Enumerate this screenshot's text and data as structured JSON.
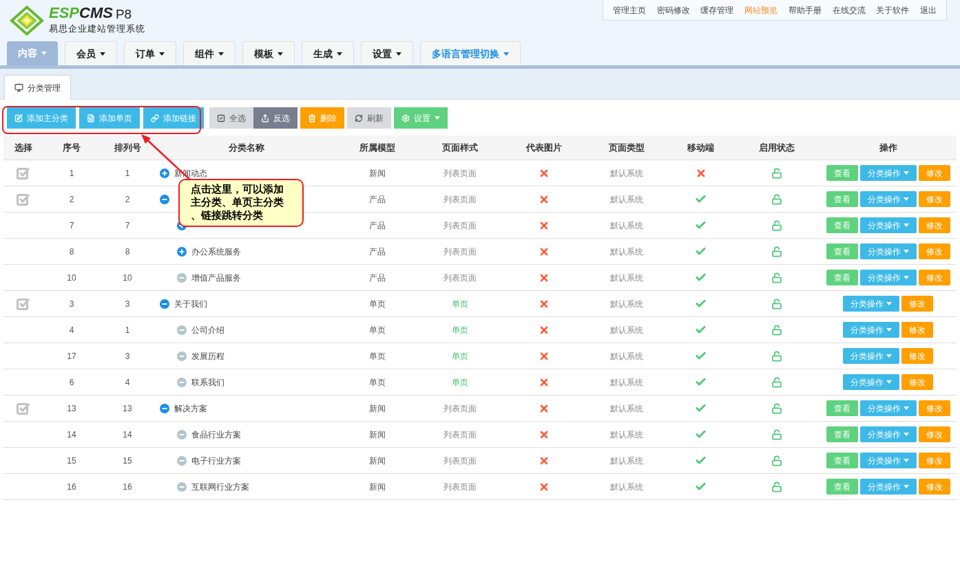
{
  "logo": {
    "brand_green": "ESP",
    "brand_dark": "CMS",
    "version": "P8",
    "subtitle": "易思企业建站管理系统"
  },
  "top_links": [
    {
      "label": "管理主页",
      "highlighted": false
    },
    {
      "label": "密码修改",
      "highlighted": false
    },
    {
      "label": "缓存管理",
      "highlighted": false
    },
    {
      "label": "网站预览",
      "highlighted": true
    },
    {
      "label": "帮助手册",
      "highlighted": false
    },
    {
      "label": "在线交流",
      "highlighted": false
    },
    {
      "label": "关于软件",
      "highlighted": false
    },
    {
      "label": "退出",
      "highlighted": false
    }
  ],
  "nav_tabs": [
    {
      "label": "内容",
      "selected": true,
      "accent": false
    },
    {
      "label": "会员",
      "selected": false,
      "accent": false
    },
    {
      "label": "订单",
      "selected": false,
      "accent": false
    },
    {
      "label": "组件",
      "selected": false,
      "accent": false
    },
    {
      "label": "模板",
      "selected": false,
      "accent": false
    },
    {
      "label": "生成",
      "selected": false,
      "accent": false
    },
    {
      "label": "设置",
      "selected": false,
      "accent": false
    },
    {
      "label": "多语言管理切换",
      "selected": false,
      "accent": true
    }
  ],
  "page_tab": {
    "label": "分类管理"
  },
  "toolbar": [
    {
      "label": "添加主分类",
      "kind": "add"
    },
    {
      "label": "添加单页",
      "kind": "page"
    },
    {
      "label": "添加链接",
      "kind": "link"
    },
    {
      "label": "全选",
      "kind": "select-all"
    },
    {
      "label": "反选",
      "kind": "invert"
    },
    {
      "label": "删除",
      "kind": "delete"
    },
    {
      "label": "刷新",
      "kind": "refresh"
    },
    {
      "label": "设置",
      "kind": "settings"
    }
  ],
  "table": {
    "columns": [
      "选择",
      "序号",
      "排列号",
      "分类名称",
      "所属模型",
      "页面样式",
      "代表图片",
      "页面类型",
      "移动端",
      "启用状态",
      "操作"
    ],
    "rows": [
      {
        "id": "1",
        "sort": "1",
        "name": "新闻动态",
        "expandable": true,
        "expanded": false,
        "model": "新闻",
        "page_style": "列表页面",
        "single_page": false,
        "image": false,
        "page_type": "默认系统",
        "mobile": false,
        "enabled": true,
        "actions": [
          {
            "label": "查看",
            "kind": "view"
          },
          {
            "label": "分类操作",
            "kind": "menu"
          },
          {
            "label": "修改",
            "kind": "edit"
          }
        ]
      },
      {
        "id": "2",
        "sort": "2",
        "expandable": true,
        "expanded": true,
        "model": "产品",
        "page_style": "列表页面",
        "single_page": false,
        "image": false,
        "page_type": "默认系统",
        "mobile": true,
        "enabled": true,
        "actions": [
          {
            "label": "查看",
            "kind": "view"
          },
          {
            "label": "分类操作",
            "kind": "menu"
          },
          {
            "label": "修改",
            "kind": "edit"
          }
        ],
        "children": [
          {
            "id": "7",
            "sort": "7",
            "expandable": true,
            "expanded": false,
            "model": "产品",
            "page_style": "列表页面",
            "single_page": false,
            "image": false,
            "page_type": "默认系统",
            "mobile": true,
            "enabled": true,
            "actions": [
              {
                "label": "查看",
                "kind": "view"
              },
              {
                "label": "分类操作",
                "kind": "menu"
              },
              {
                "label": "修改",
                "kind": "edit"
              }
            ]
          },
          {
            "id": "8",
            "sort": "8",
            "name": "办公系统服务",
            "expandable": true,
            "expanded": false,
            "model": "产品",
            "page_style": "列表页面",
            "single_page": false,
            "image": false,
            "page_type": "默认系统",
            "mobile": true,
            "enabled": true,
            "actions": [
              {
                "label": "查看",
                "kind": "view"
              },
              {
                "label": "分类操作",
                "kind": "menu"
              },
              {
                "label": "修改",
                "kind": "edit"
              }
            ]
          },
          {
            "id": "10",
            "sort": "10",
            "name": "增值产品服务",
            "expandable": false,
            "model": "产品",
            "page_style": "列表页面",
            "single_page": false,
            "image": false,
            "page_type": "默认系统",
            "mobile": true,
            "enabled": true,
            "actions": [
              {
                "label": "查看",
                "kind": "view"
              },
              {
                "label": "分类操作",
                "kind": "menu"
              },
              {
                "label": "修改",
                "kind": "edit"
              }
            ]
          }
        ]
      },
      {
        "id": "3",
        "sort": "3",
        "name": "关于我们",
        "expandable": true,
        "expanded": true,
        "model": "单页",
        "page_style": "单页",
        "single_page": true,
        "image": false,
        "page_type": "默认系统",
        "mobile": true,
        "enabled": true,
        "actions": [
          {
            "label": "分类操作",
            "kind": "menu"
          },
          {
            "label": "修改",
            "kind": "edit"
          }
        ],
        "children": [
          {
            "id": "4",
            "sort": "1",
            "name": "公司介绍",
            "expandable": false,
            "model": "单页",
            "page_style": "单页",
            "single_page": true,
            "image": false,
            "page_type": "默认系统",
            "mobile": true,
            "enabled": true,
            "actions": [
              {
                "label": "分类操作",
                "kind": "menu"
              },
              {
                "label": "修改",
                "kind": "edit"
              }
            ]
          },
          {
            "id": "17",
            "sort": "3",
            "name": "发展历程",
            "expandable": false,
            "model": "单页",
            "page_style": "单页",
            "single_page": true,
            "image": false,
            "page_type": "默认系统",
            "mobile": true,
            "enabled": true,
            "actions": [
              {
                "label": "分类操作",
                "kind": "menu"
              },
              {
                "label": "修改",
                "kind": "edit"
              }
            ]
          },
          {
            "id": "6",
            "sort": "4",
            "name": "联系我们",
            "expandable": false,
            "model": "单页",
            "page_style": "单页",
            "single_page": true,
            "image": false,
            "page_type": "默认系统",
            "mobile": true,
            "enabled": true,
            "actions": [
              {
                "label": "分类操作",
                "kind": "menu"
              },
              {
                "label": "修改",
                "kind": "edit"
              }
            ]
          }
        ]
      },
      {
        "id": "13",
        "sort": "13",
        "name": "解决方案",
        "expandable": true,
        "expanded": true,
        "model": "新闻",
        "page_style": "列表页面",
        "single_page": false,
        "image": false,
        "page_type": "默认系统",
        "mobile": true,
        "enabled": true,
        "actions": [
          {
            "label": "查看",
            "kind": "view"
          },
          {
            "label": "分类操作",
            "kind": "menu"
          },
          {
            "label": "修改",
            "kind": "edit"
          }
        ],
        "children": [
          {
            "id": "14",
            "sort": "14",
            "name": "食品行业方案",
            "expandable": false,
            "model": "新闻",
            "page_style": "列表页面",
            "single_page": false,
            "image": false,
            "page_type": "默认系统",
            "mobile": true,
            "enabled": true,
            "actions": [
              {
                "label": "查看",
                "kind": "view"
              },
              {
                "label": "分类操作",
                "kind": "menu"
              },
              {
                "label": "修改",
                "kind": "edit"
              }
            ]
          },
          {
            "id": "15",
            "sort": "15",
            "name": "电子行业方案",
            "expandable": false,
            "model": "新闻",
            "page_style": "列表页面",
            "single_page": false,
            "image": false,
            "page_type": "默认系统",
            "mobile": true,
            "enabled": true,
            "actions": [
              {
                "label": "查看",
                "kind": "view"
              },
              {
                "label": "分类操作",
                "kind": "menu"
              },
              {
                "label": "修改",
                "kind": "edit"
              }
            ]
          },
          {
            "id": "16",
            "sort": "16",
            "name": "互联网行业方案",
            "expandable": false,
            "model": "新闻",
            "page_style": "列表页面",
            "single_page": false,
            "image": false,
            "page_type": "默认系统",
            "mobile": true,
            "enabled": true,
            "actions": [
              {
                "label": "查看",
                "kind": "view"
              },
              {
                "label": "分类操作",
                "kind": "menu"
              },
              {
                "label": "修改",
                "kind": "edit"
              }
            ]
          }
        ]
      }
    ]
  },
  "callout": {
    "text": "点击这里，可以添加主分类、单页主分类、链接跳转分类"
  }
}
